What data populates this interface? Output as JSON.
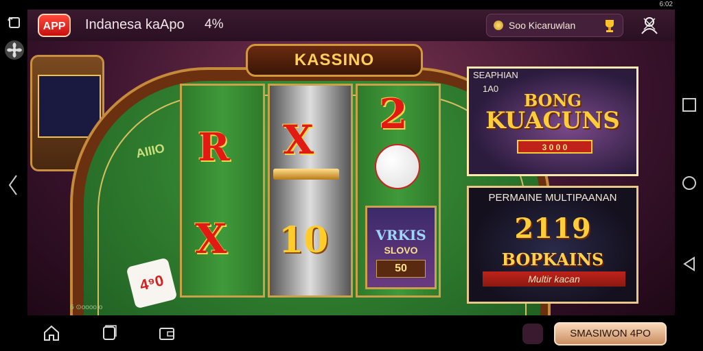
{
  "status_bar": {
    "right_text": "6:02"
  },
  "header": {
    "app_badge": "APP",
    "title": "Indanesa kaApo",
    "percent": "4%",
    "search_text": "Soo Kicaruwlan",
    "icons": [
      "coin-icon",
      "trophy-icon",
      "profile-icon"
    ]
  },
  "game": {
    "sign_text": "KASSINO",
    "felt_label": "AIIIO",
    "corner_text": "6 ⊙oooo.o",
    "reel1": [
      "R",
      "X"
    ],
    "reel2": [
      "X",
      "10"
    ],
    "reel3": {
      "top": "2",
      "card_title": "VRKIS",
      "card_sub": "SLOVO",
      "card_value": "50"
    },
    "dice_text": "4⁹0"
  },
  "promos": [
    {
      "caption": "SEAPHIAN",
      "caption2": "1A0",
      "title1": "BONG",
      "title2": "KUACUNS",
      "ribbon": "3 0 0 0"
    },
    {
      "caption": "PERMAINE MULTIPAANAN",
      "number": "2119",
      "name": "BOPKAINS",
      "subtitle": "Multir kacan"
    }
  ],
  "bottom": {
    "cta_label": "SMASIWON 4PO"
  },
  "colors": {
    "accent": "#c0221a",
    "gold": "#ffcc2a",
    "felt": "#3f9a3a",
    "header_bg": "#2a0f22"
  }
}
